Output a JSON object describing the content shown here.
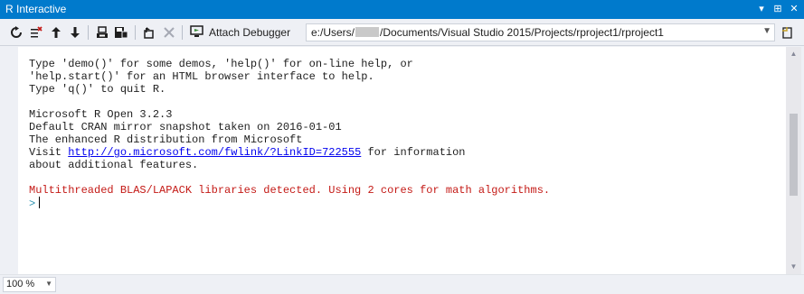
{
  "window": {
    "title": "R Interactive",
    "controls": [
      "▾",
      "⊞",
      "✕"
    ]
  },
  "toolbar": {
    "attach_label": "Attach Debugger",
    "path_prefix": "e:/Users/",
    "path_suffix": "/Documents/Visual Studio 2015/Projects/rproject1/rproject1"
  },
  "console": {
    "lines_1": "Type 'demo()' for some demos, 'help()' for on-line help, or\n'help.start()' for an HTML browser interface to help.\nType 'q()' to quit R.\n\nMicrosoft R Open 3.2.3\nDefault CRAN mirror snapshot taken on 2016-01-01\nThe enhanced R distribution from Microsoft\nVisit ",
    "link": "http://go.microsoft.com/fwlink/?LinkID=722555",
    "lines_2": " for information\nabout additional features.\n\n",
    "warning": "Multithreaded BLAS/LAPACK libraries detected. Using 2 cores for math algorithms.",
    "prompt": ">"
  },
  "zoom": {
    "value": "100 %"
  },
  "colors": {
    "accent": "#007acc",
    "warning": "#c41a16",
    "link": "#0000ee"
  }
}
